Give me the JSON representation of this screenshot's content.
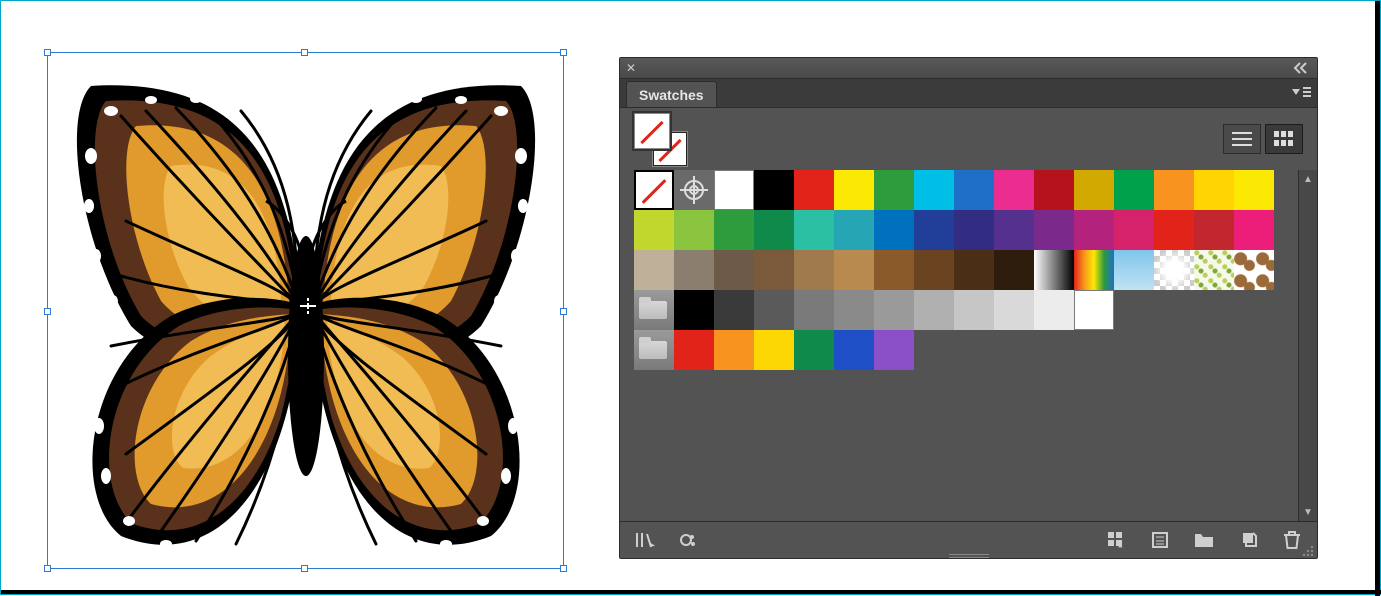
{
  "artwork": {
    "name": "butterfly-artwork",
    "selected": true
  },
  "panel": {
    "title": "Swatches",
    "active_view": "thumb",
    "fill": "none",
    "stroke": "none",
    "rows": [
      [
        {
          "type": "none"
        },
        {
          "type": "registration"
        },
        {
          "type": "color",
          "hex": "#ffffff",
          "border": true
        },
        {
          "type": "color",
          "hex": "#000000"
        },
        {
          "type": "color",
          "hex": "#e2231a"
        },
        {
          "type": "color",
          "hex": "#fce903"
        },
        {
          "type": "color",
          "hex": "#2e9b3d"
        },
        {
          "type": "color",
          "hex": "#00bfe6"
        },
        {
          "type": "color",
          "hex": "#1e6fc7"
        },
        {
          "type": "color",
          "hex": "#ea2d8f"
        },
        {
          "type": "color",
          "hex": "#b5121b"
        },
        {
          "type": "color",
          "hex": "#d1a900"
        },
        {
          "type": "color",
          "hex": "#00a14b"
        },
        {
          "type": "color",
          "hex": "#f7931e"
        },
        {
          "type": "color",
          "hex": "#ffd400"
        },
        {
          "type": "color",
          "hex": "#fce903"
        }
      ],
      [
        {
          "type": "color",
          "hex": "#c1d72e"
        },
        {
          "type": "color",
          "hex": "#8bc53f"
        },
        {
          "type": "color",
          "hex": "#2e9b3d"
        },
        {
          "type": "color",
          "hex": "#0f8a4b"
        },
        {
          "type": "color",
          "hex": "#2bbfa3"
        },
        {
          "type": "color",
          "hex": "#26a6b5"
        },
        {
          "type": "color",
          "hex": "#0071bc"
        },
        {
          "type": "color",
          "hex": "#213f99"
        },
        {
          "type": "color",
          "hex": "#332c83"
        },
        {
          "type": "color",
          "hex": "#56308f"
        },
        {
          "type": "color",
          "hex": "#7a2a8a"
        },
        {
          "type": "color",
          "hex": "#b3227c"
        },
        {
          "type": "color",
          "hex": "#d6216b"
        },
        {
          "type": "color",
          "hex": "#e2231a"
        },
        {
          "type": "color",
          "hex": "#c1272d"
        },
        {
          "type": "color",
          "hex": "#ed1e79"
        }
      ],
      [
        {
          "type": "color",
          "hex": "#bfb09a"
        },
        {
          "type": "color",
          "hex": "#8a7f6e"
        },
        {
          "type": "color",
          "hex": "#6e5a48"
        },
        {
          "type": "color",
          "hex": "#7a5a3a"
        },
        {
          "type": "color",
          "hex": "#a07a4d"
        },
        {
          "type": "color",
          "hex": "#b98a4f"
        },
        {
          "type": "color",
          "hex": "#8a5a2a"
        },
        {
          "type": "color",
          "hex": "#6a4320"
        },
        {
          "type": "color",
          "hex": "#4a2e16"
        },
        {
          "type": "color",
          "hex": "#2e1c0d"
        },
        {
          "type": "grad-bw"
        },
        {
          "type": "grad-rainbow"
        },
        {
          "type": "grad-sky"
        },
        {
          "type": "transp"
        },
        {
          "type": "pat1"
        },
        {
          "type": "pat2"
        }
      ],
      [
        {
          "type": "folder"
        },
        {
          "type": "color",
          "hex": "#000000"
        },
        {
          "type": "color",
          "hex": "#3a3a3a"
        },
        {
          "type": "color",
          "hex": "#5a5a5a"
        },
        {
          "type": "color",
          "hex": "#7a7a7a"
        },
        {
          "type": "color",
          "hex": "#8a8a8a"
        },
        {
          "type": "color",
          "hex": "#9a9a9a"
        },
        {
          "type": "color",
          "hex": "#b0b0b0"
        },
        {
          "type": "color",
          "hex": "#c6c6c6"
        },
        {
          "type": "color",
          "hex": "#d9d9d9"
        },
        {
          "type": "color",
          "hex": "#ececec"
        },
        {
          "type": "color",
          "hex": "#ffffff",
          "border": true
        }
      ],
      [
        {
          "type": "folder"
        },
        {
          "type": "color",
          "hex": "#e2231a"
        },
        {
          "type": "color",
          "hex": "#f7931e"
        },
        {
          "type": "color",
          "hex": "#fcd703"
        },
        {
          "type": "color",
          "hex": "#0f8a4b"
        },
        {
          "type": "color",
          "hex": "#1e4fc7"
        },
        {
          "type": "color",
          "hex": "#8b4fc7"
        }
      ]
    ],
    "footer_buttons": [
      "swatch-libraries",
      "show-kinds",
      "swatch-options",
      "new-group",
      "new-folder",
      "new-swatch",
      "delete"
    ]
  }
}
